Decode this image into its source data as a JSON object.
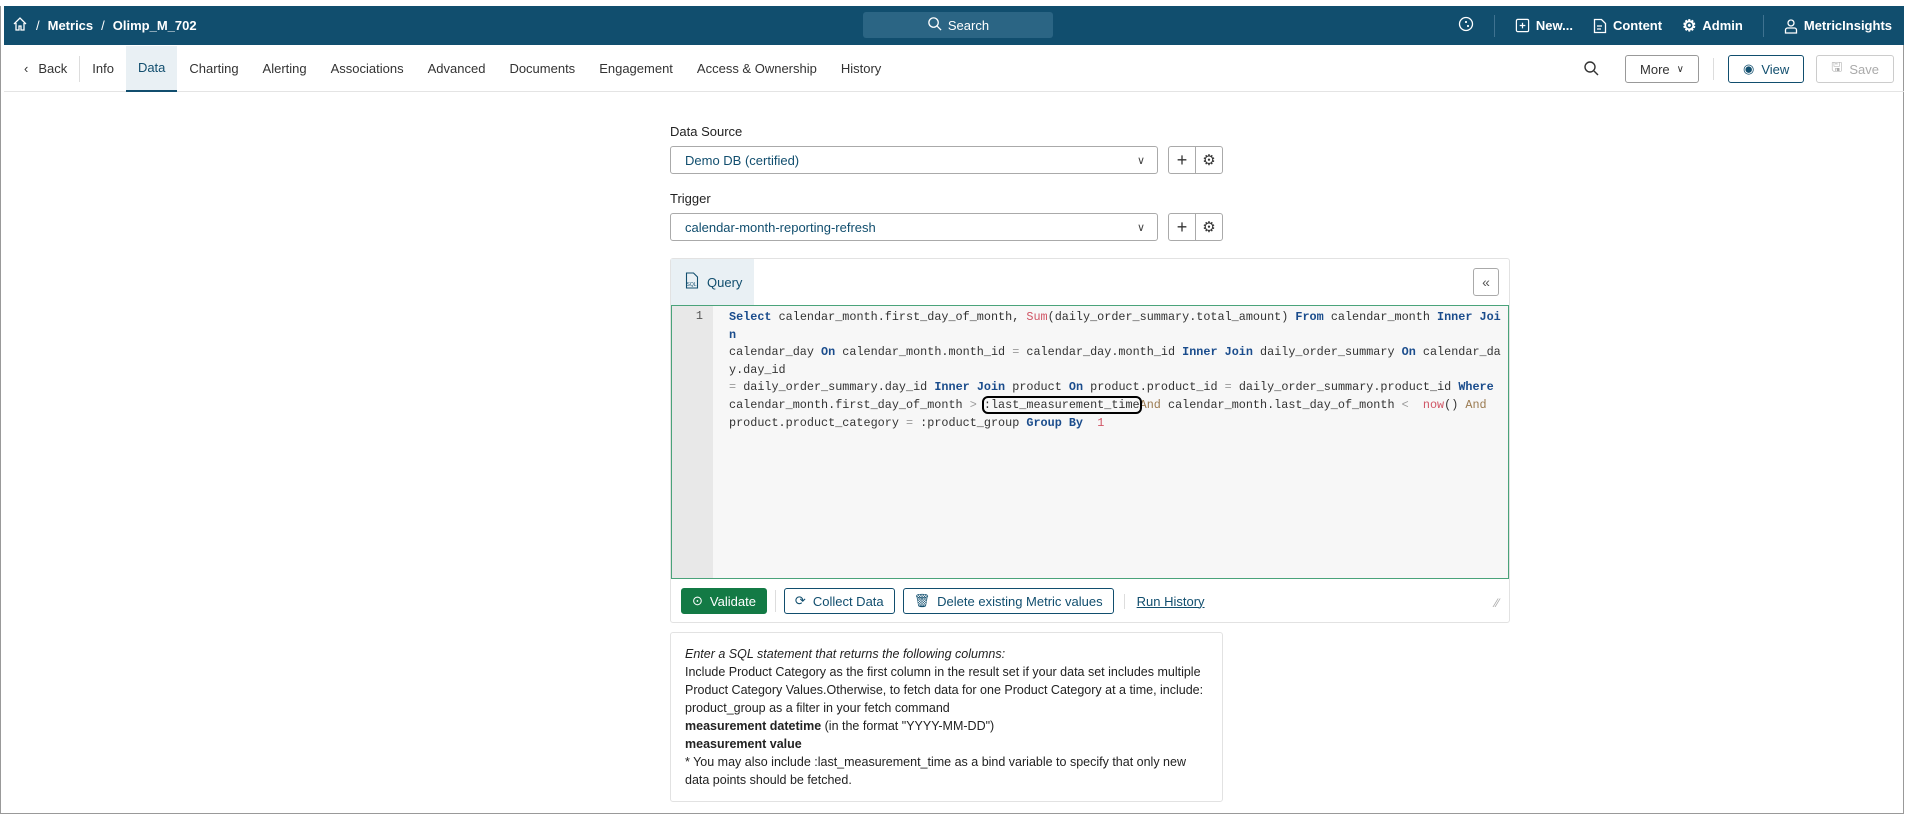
{
  "header": {
    "breadcrumbs": [
      "Metrics",
      "Olimp_M_702"
    ],
    "search_label": "Search",
    "new_label": "New...",
    "content_label": "Content",
    "admin_label": "Admin",
    "user_label": "MetricInsights"
  },
  "tabs": {
    "back": "Back",
    "items": [
      "Info",
      "Data",
      "Charting",
      "Alerting",
      "Associations",
      "Advanced",
      "Documents",
      "Engagement",
      "Access & Ownership",
      "History"
    ],
    "active": "Data"
  },
  "toolbar": {
    "more": "More",
    "view": "View",
    "save": "Save"
  },
  "form": {
    "data_source_label": "Data Source",
    "data_source_value": "Demo DB (certified)",
    "trigger_label": "Trigger",
    "trigger_value": "calendar-month-reporting-refresh"
  },
  "query": {
    "tab_label": "Query",
    "line_number": "1",
    "tokens": [
      [
        "k",
        "Select"
      ],
      [
        "",
        "calendar_month.first_day_of_month, "
      ],
      [
        "f",
        "Sum"
      ],
      [
        "",
        "(daily_order_summary.total_amount) "
      ],
      [
        "k",
        "From"
      ],
      [
        "",
        "calendar_month "
      ],
      [
        "k",
        "Inner Join"
      ],
      [
        "",
        "\ncalendar_day "
      ],
      [
        "k",
        "On"
      ],
      [
        "",
        "calendar_month.month_id "
      ],
      [
        "o",
        "="
      ],
      [
        "",
        "calendar_day.month_id "
      ],
      [
        "k",
        "Inner Join"
      ],
      [
        "",
        "daily_order_summary "
      ],
      [
        "k",
        "On"
      ],
      [
        "",
        "calendar_day.day_id\n"
      ],
      [
        "o",
        "="
      ],
      [
        "",
        "daily_order_summary.day_id "
      ],
      [
        "k",
        "Inner Join"
      ],
      [
        "",
        "product "
      ],
      [
        "k",
        "On"
      ],
      [
        "",
        "product.product_id "
      ],
      [
        "o",
        "="
      ],
      [
        "",
        "daily_order_summary.product_id "
      ],
      [
        "k",
        "Where"
      ],
      [
        "",
        "\ncalendar_month.first_day_of_month "
      ],
      [
        "o",
        ">"
      ],
      [
        "hl",
        ":last_measurement_time"
      ],
      [
        "a",
        "And"
      ],
      [
        "",
        "calendar_month.last_day_of_month "
      ],
      [
        "o",
        "<"
      ],
      [
        "f",
        " now"
      ],
      [
        "",
        "() "
      ],
      [
        "a",
        "And"
      ],
      [
        "",
        "\nproduct.product_category "
      ],
      [
        "o",
        "="
      ],
      [
        "",
        ":product_group "
      ],
      [
        "k",
        "Group By"
      ],
      [
        "n",
        " 1"
      ]
    ]
  },
  "actions": {
    "validate": "Validate",
    "collect": "Collect Data",
    "delete": "Delete existing Metric values",
    "run_history": "Run History"
  },
  "help": {
    "intro": "Enter a SQL statement that returns the following columns:",
    "line1": "Include Product Category as the first column in the result set if your data set includes multiple Product Category Values.Otherwise, to fetch data for one Product Category at a time, include: product_group as a filter in your fetch command",
    "datetime_bold": "measurement datetime",
    "datetime_rest": " (in the format \"YYYY-MM-DD\")",
    "value_bold": "measurement value",
    "note": "* You may also include :last_measurement_time as a bind variable to specify that only new data points should be fetched."
  }
}
